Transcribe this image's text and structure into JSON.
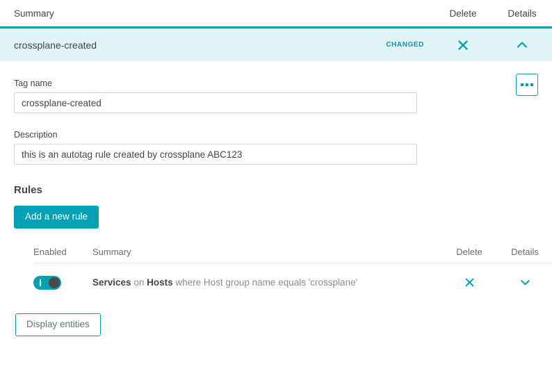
{
  "tag_table": {
    "columns": {
      "summary": "Summary",
      "delete": "Delete",
      "details": "Details"
    },
    "row": {
      "name": "crossplane-created",
      "status_badge": "CHANGED",
      "delete_icon": "close-x-icon",
      "details_icon": "chevron-up-icon"
    }
  },
  "detail": {
    "overflow_button_icon": "ellipsis-icon",
    "tag_name": {
      "label": "Tag name",
      "value": "crossplane-created",
      "placeholder": "Tag name"
    },
    "description": {
      "label": "Description",
      "value": "this is an autotag rule created by crossplane ABC123",
      "placeholder": "Description"
    }
  },
  "rules": {
    "title": "Rules",
    "add_button": "Add a new rule",
    "columns": {
      "enabled": "Enabled",
      "summary": "Summary",
      "delete": "Delete",
      "details": "Details"
    },
    "items": [
      {
        "enabled": true,
        "summary_part_1": "Services",
        "summary_part_2": " on ",
        "summary_part_3": "Hosts",
        "summary_part_4": " where Host group name equals 'crossplane'",
        "delete_icon": "close-x-icon",
        "details_icon": "chevron-down-icon"
      }
    ]
  },
  "footer": {
    "display_entities_button": "Display entities"
  },
  "colors": {
    "accent_teal": "#00a1b2",
    "row_highlight": "#e1f4f8",
    "badge_teal": "#1496a8",
    "text_primary": "#454646",
    "text_muted": "#8d8d8d"
  }
}
